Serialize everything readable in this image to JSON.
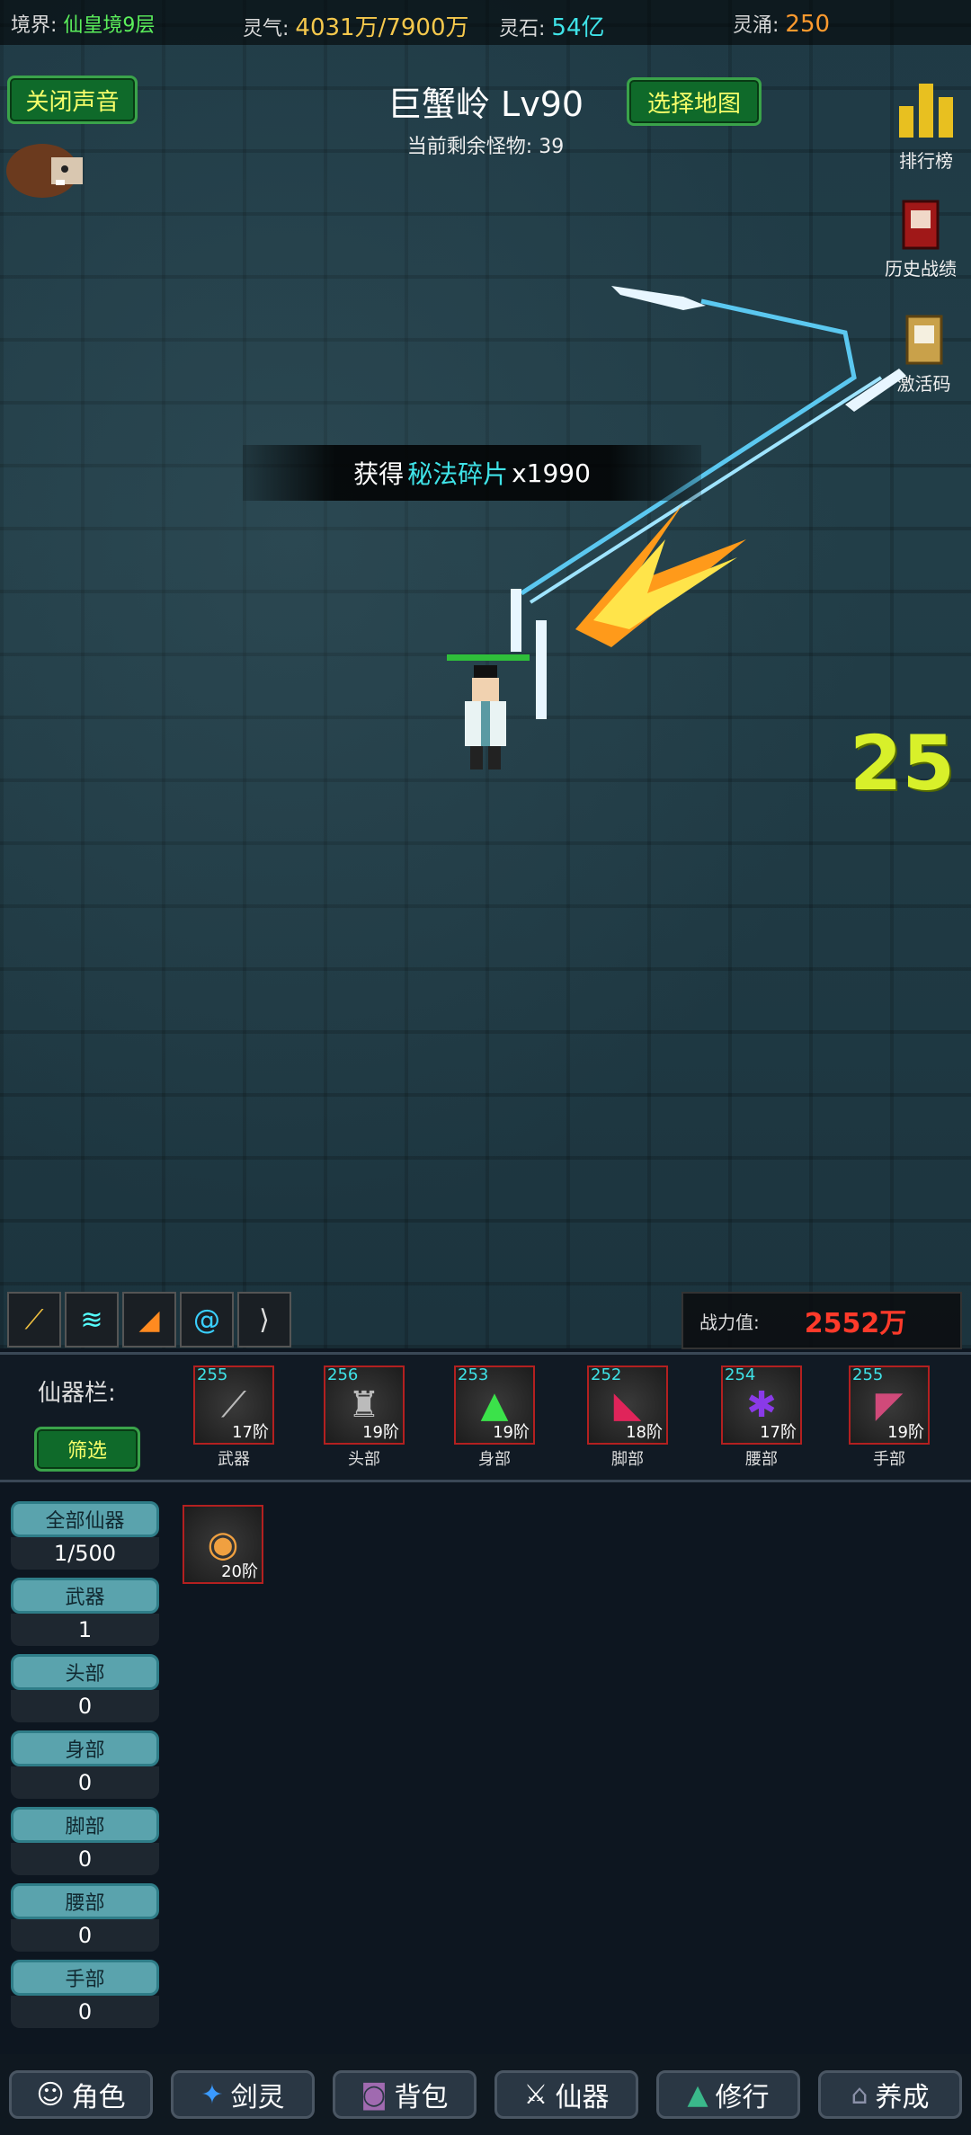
{
  "topbar": {
    "realm_label": "境界:",
    "realm_value": "仙皇境9层",
    "qi_label": "灵气:",
    "qi_value": "4031万/7900万",
    "stone_label": "灵石:",
    "stone_value": "54亿",
    "lingyong_label": "灵涌:",
    "lingyong_value": "250"
  },
  "buttons": {
    "sound": "关闭声音",
    "select_map": "选择地图",
    "filter": "筛选"
  },
  "map": {
    "name": "巨蟹岭",
    "level": "Lv90",
    "remaining_label": "当前剩余怪物:",
    "remaining_value": "39"
  },
  "right_icons": {
    "rank": "排行榜",
    "history": "历史战绩",
    "code": "激活码"
  },
  "banner": {
    "prefix": "获得",
    "item": "秘法碎片",
    "count": "x1990"
  },
  "damage_number": "25",
  "power": {
    "label": "战力值:",
    "value": "2552万"
  },
  "equip_bar": {
    "label": "仙器栏:",
    "slots": [
      {
        "level": "255",
        "stars": "17阶",
        "name": "武器"
      },
      {
        "level": "256",
        "stars": "19阶",
        "name": "头部"
      },
      {
        "level": "253",
        "stars": "19阶",
        "name": "身部"
      },
      {
        "level": "252",
        "stars": "18阶",
        "name": "脚部"
      },
      {
        "level": "254",
        "stars": "17阶",
        "name": "腰部"
      },
      {
        "level": "255",
        "stars": "19阶",
        "name": "手部"
      }
    ]
  },
  "categories": [
    {
      "label": "全部仙器",
      "count": "1/500"
    },
    {
      "label": "武器",
      "count": "1"
    },
    {
      "label": "头部",
      "count": "0"
    },
    {
      "label": "身部",
      "count": "0"
    },
    {
      "label": "脚部",
      "count": "0"
    },
    {
      "label": "腰部",
      "count": "0"
    },
    {
      "label": "手部",
      "count": "0"
    }
  ],
  "inventory_item": {
    "stars": "20阶"
  },
  "nav": [
    "角色",
    "剑灵",
    "背包",
    "仙器",
    "修行",
    "养成"
  ],
  "colors": {
    "accent_green": "#0f6a2a",
    "text_gold": "#f5c84c",
    "text_cyan": "#3fe3e8",
    "power_red": "#ff3a2a"
  }
}
